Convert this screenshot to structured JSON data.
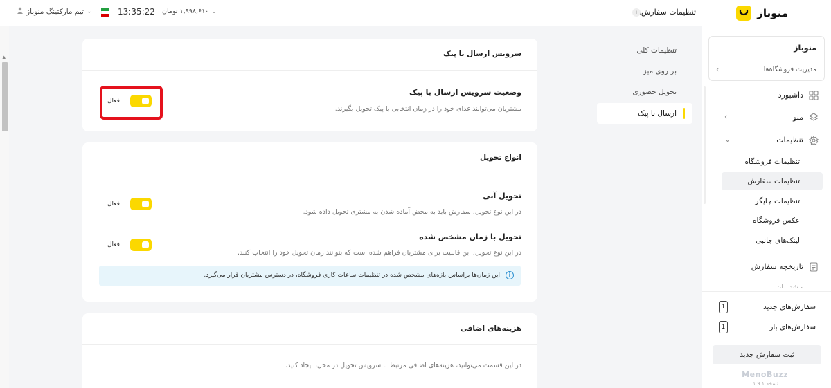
{
  "sidebar": {
    "brand": "منوباز",
    "store_name": "منوباز",
    "store_manage": "مدیریت فروشگاه‌ها",
    "nav": {
      "dashboard": "داشبورد",
      "menu": "منو",
      "settings": "تنظیمات",
      "order_history": "تاریخچه سفارش",
      "customers": "مشتریان"
    },
    "settings_sub": [
      "تنظیمات فروشگاه",
      "تنظیمات سفارش",
      "تنظیمات چاپگر",
      "عکس فروشگاه",
      "لینک‌های جانبی"
    ],
    "new_orders_label": "سفارش‌های جدید",
    "new_orders_count": "1",
    "open_orders_label": "سفارش‌های باز",
    "open_orders_count": "1",
    "new_order_button": "ثبت سفارش جدید",
    "footer_logo": "MenoBuzz",
    "footer_version": "نسخه ۱.۹.۱"
  },
  "topbar": {
    "title": "تنظیمات سفارش‌ها",
    "credit": "۱,۹۹۸,۶۱۰ تومان",
    "clock": "13:35:22",
    "team": "تیم مارکتینگ منوباز"
  },
  "subnav": [
    "تنظیمات کلی",
    "بر روی میز",
    "تحویل حضوری",
    "ارسال با پیک"
  ],
  "courier_card": {
    "title": "سرویس ارسال با پیک",
    "row_title": "وضعیت سرویس ارسال با پیک",
    "row_desc": "مشتریان می‌توانند غذای خود را در زمان انتخابی با پیک تحویل بگیرند.",
    "toggle_label": "فعال",
    "toggle_on": true
  },
  "delivery_card": {
    "title": "انواع تحویل",
    "instant_title": "تحویل آنی",
    "instant_desc": "در این نوع تحویل، سفارش باید به محض آماده شدن به مشتری تحویل داده شود.",
    "instant_toggle": "فعال",
    "scheduled_title": "تحویل با زمان مشخص شده",
    "scheduled_desc": "در این نوع تحویل، این قابلیت برای مشتریان فراهم شده است که بتوانند زمان تحویل خود را انتخاب کنند.",
    "scheduled_toggle": "فعال",
    "info": "این زمان‌ها براساس بازه‌های مشخص شده در تنظیمات ساعات کاری فروشگاه، در دسترس مشتریان قرار می‌گیرد."
  },
  "fees_card": {
    "title": "هزینه‌های اضافی",
    "desc": "در این قسمت می‌توانید، هزینه‌های اضافی مرتبط با سرویس تحویل در محل، ایجاد کنید."
  },
  "colors": {
    "accent": "#fbd800",
    "highlight": "#e5121d",
    "info_bg": "#e7f5fb"
  }
}
